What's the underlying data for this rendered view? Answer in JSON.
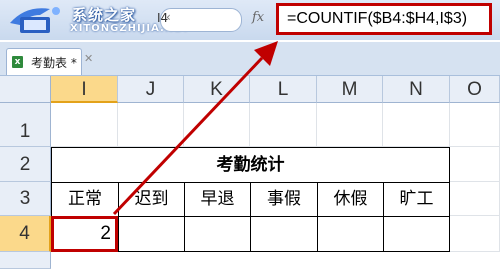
{
  "watermark": {
    "name": "系统之家",
    "url": "XITONGZHIJIA.NET"
  },
  "name_box": {
    "value": "I4"
  },
  "formula_bar": {
    "fx_label": "fx",
    "formula": "=COUNTIF($B4:$H4,I$3)"
  },
  "sheet_tab": {
    "label": "考勤表 *"
  },
  "columns": [
    "I",
    "J",
    "K",
    "L",
    "M",
    "N",
    "O"
  ],
  "rows": [
    "1",
    "2",
    "3",
    "4"
  ],
  "table": {
    "title": "考勤统计",
    "headers": [
      "正常",
      "迟到",
      "早退",
      "事假",
      "休假",
      "旷工"
    ],
    "values": [
      "2",
      "",
      "",
      "",
      "",
      ""
    ]
  },
  "colors": {
    "highlight": "#c00000",
    "selected_header": "#fbd98b"
  }
}
